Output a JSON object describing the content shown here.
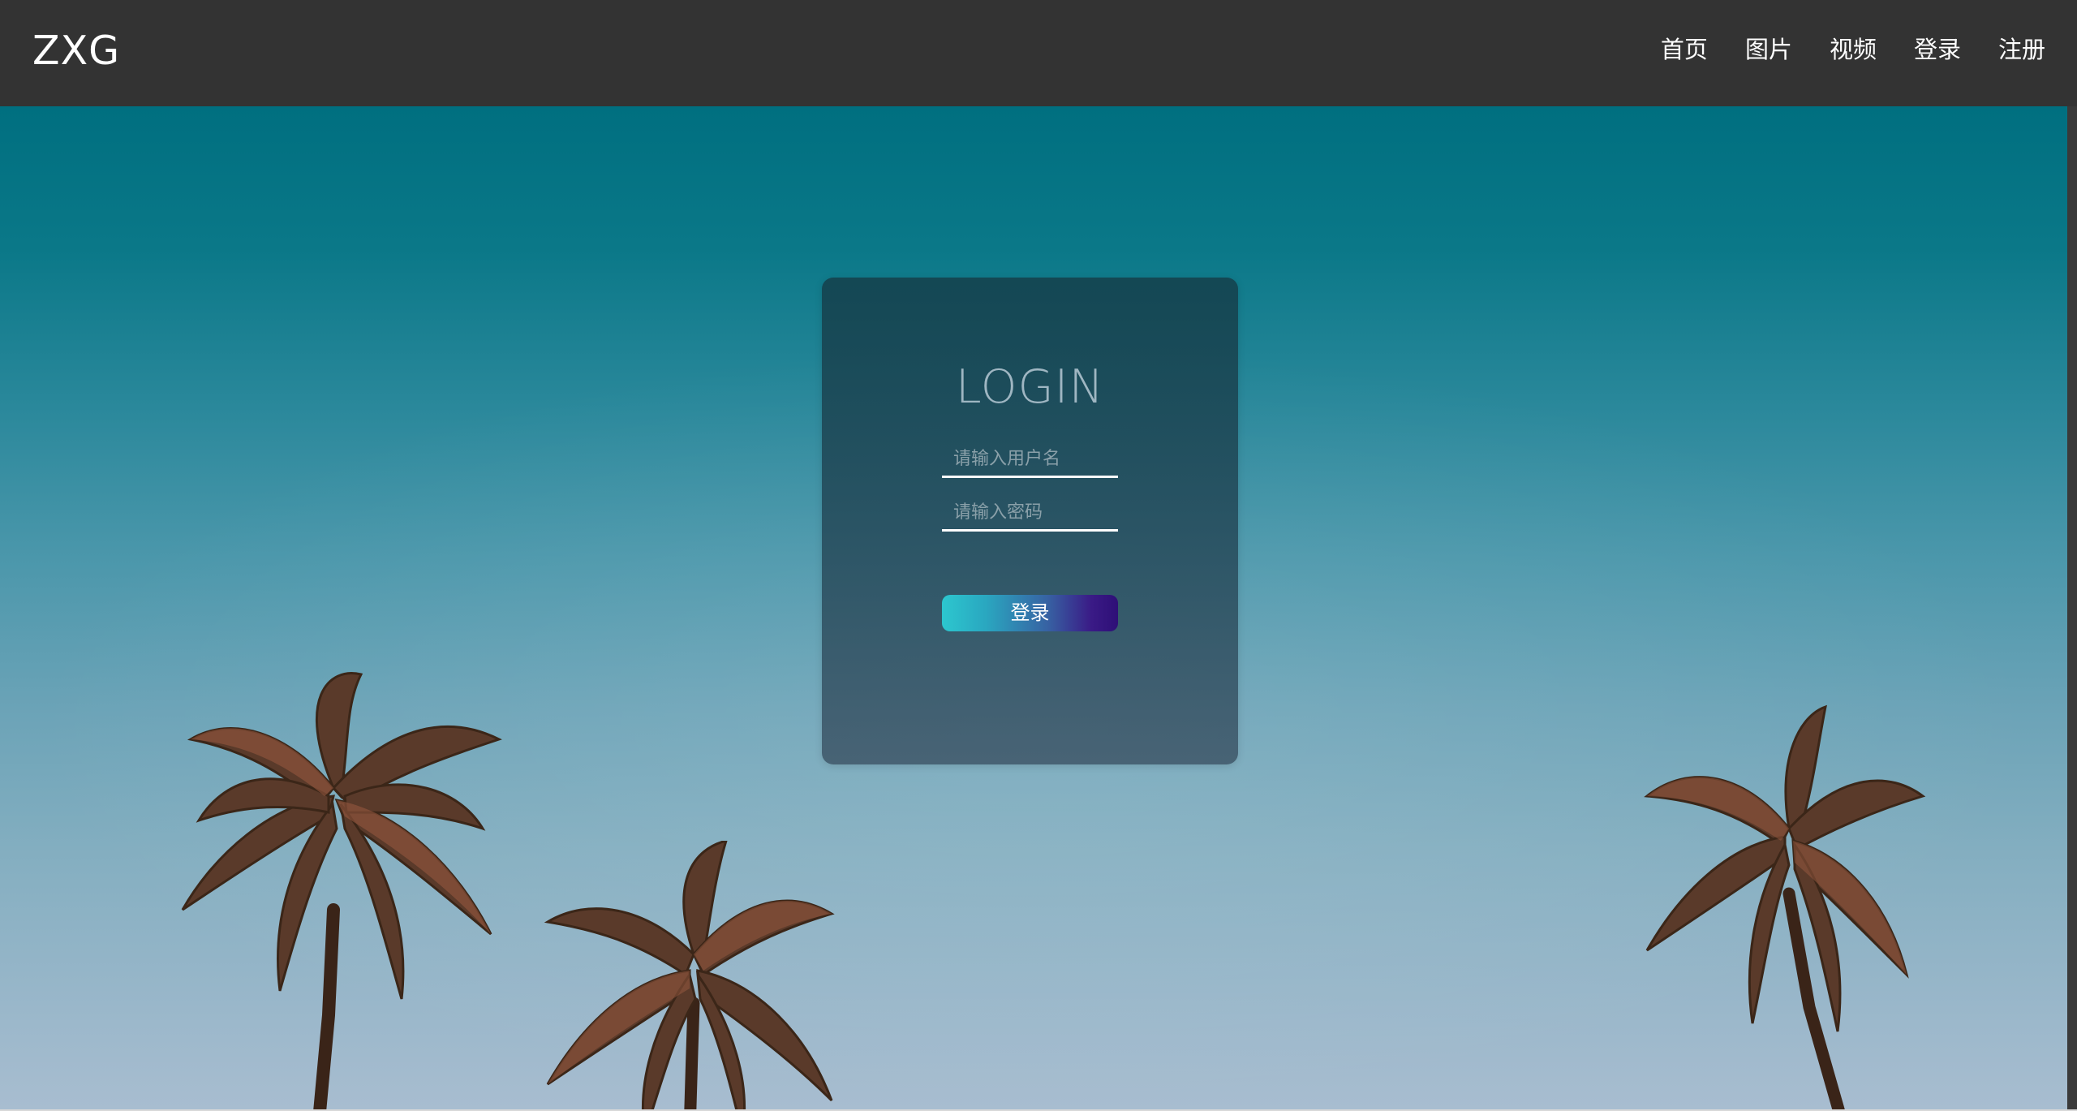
{
  "header": {
    "logo": "ZXG",
    "nav": [
      {
        "label": "首页"
      },
      {
        "label": "图片"
      },
      {
        "label": "视频"
      },
      {
        "label": "登录"
      },
      {
        "label": "注册"
      }
    ]
  },
  "login": {
    "title": "LOGIN",
    "username_placeholder": "请输入用户名",
    "password_placeholder": "请输入密码",
    "submit_label": "登录"
  },
  "colors": {
    "header_bg": "#333333",
    "sky_top": "#006f80",
    "sky_bottom": "#a8bdd0",
    "button_gradient_start": "#2cc7cf",
    "button_gradient_end": "#2e0f77"
  }
}
